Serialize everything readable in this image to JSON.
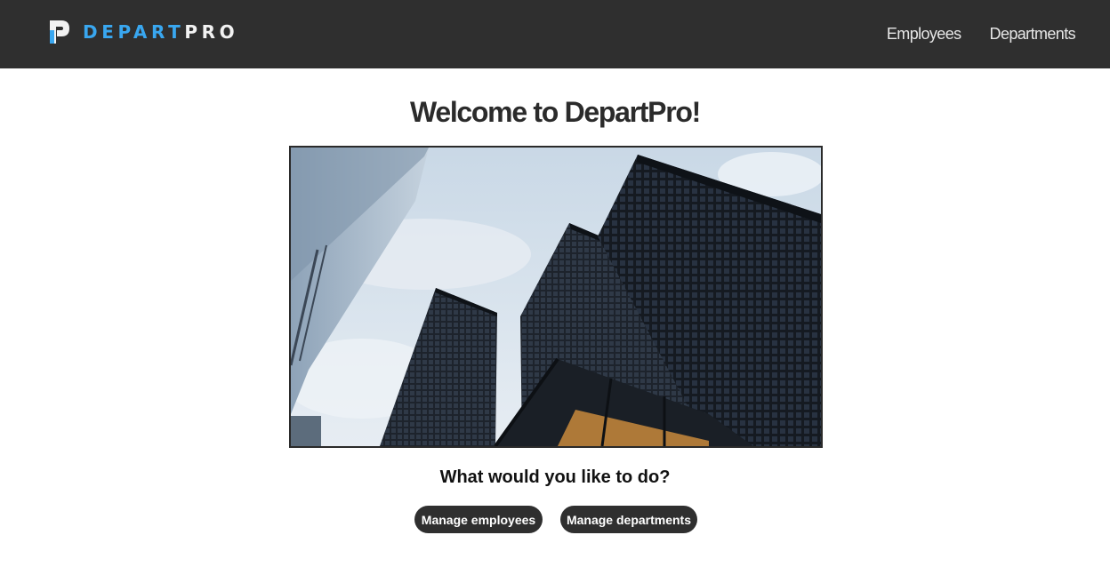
{
  "brand": {
    "name_part1": "DEPART",
    "name_part2": "PRO",
    "colors": {
      "accent": "#39a7f0",
      "navbar": "#2f2f2f",
      "button": "#2f2f2f"
    }
  },
  "nav": {
    "links": [
      "Employees",
      "Departments"
    ]
  },
  "main": {
    "title": "Welcome to DepartPro!",
    "hero_image": "office-skyscrapers-photo",
    "question": "What would you like to do?",
    "actions": {
      "manage_employees": "Manage employees",
      "manage_departments": "Manage departments"
    }
  }
}
